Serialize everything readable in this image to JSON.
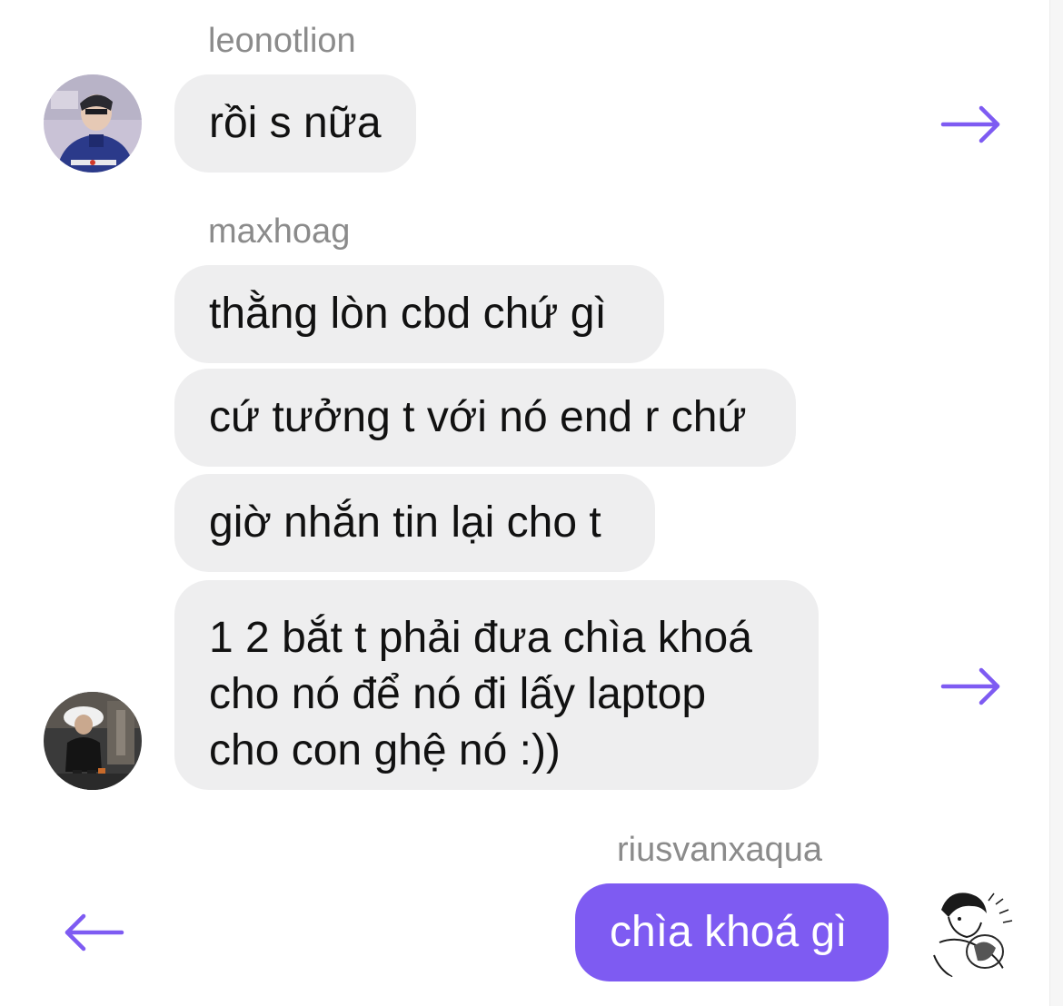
{
  "thread": {
    "group1": {
      "sender": "leonotlion",
      "messages": [
        "rồi s nữa"
      ]
    },
    "group2": {
      "sender": "maxhoag",
      "messages": [
        "thằng lòn cbd chứ gì",
        "cứ tưởng t với nó end r chứ",
        "giờ nhắn tin lại cho t"
      ],
      "multiline": [
        "1 2 bắt t phải đưa chìa khoá",
        "cho nó để nó đi lấy laptop",
        "cho con ghệ nó :))"
      ]
    },
    "group3": {
      "sender": "riusvanxaqua",
      "messages": [
        "chìa khoá gì"
      ]
    }
  },
  "colors": {
    "accent": "#7e5bf2",
    "incoming_bubble": "#eeeeef",
    "sender_name": "#8b8b8b"
  },
  "icons": {
    "share_right": "arrow-right-icon",
    "share_left": "arrow-left-icon"
  }
}
